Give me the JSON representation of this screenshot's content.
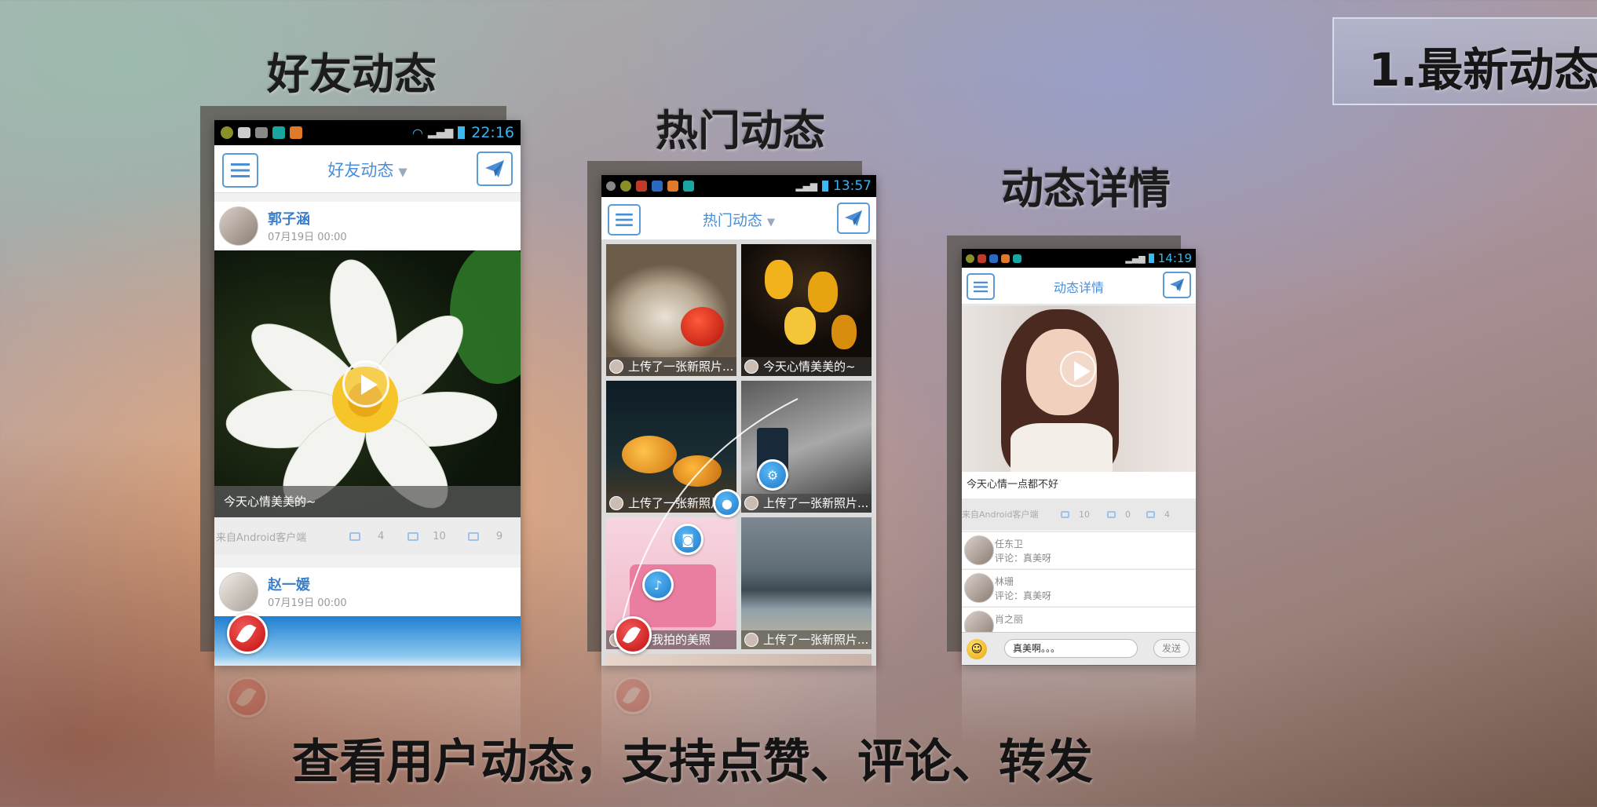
{
  "section": {
    "title": "1.最新动态"
  },
  "headings": {
    "friends": "好友动态",
    "hot": "热门动态",
    "detail": "动态详情"
  },
  "bottom_caption": "查看用户动态，支持点赞、评论、转发",
  "phone1": {
    "time": "22:16",
    "title": "好友动态",
    "posts": [
      {
        "user": "郭子涵",
        "time": "07月19日 00:00",
        "caption": "今天心情美美的~",
        "source": "来自Android客户端",
        "comments": "4",
        "forwards": "10",
        "likes": "9"
      },
      {
        "user": "赵一媛",
        "time": "07月19日 00:00"
      }
    ]
  },
  "phone2": {
    "time": "13:57",
    "title": "热门动态",
    "tiles": [
      "上传了一张新照片...",
      "今天心情美美的~",
      "上传了一张新照片...",
      "上传了一张新照片...",
      "我拍的美照",
      "上传了一张新照片..."
    ]
  },
  "phone3": {
    "time": "14:19",
    "title": "动态详情",
    "post_text": "今天心情一点都不好",
    "source": "来自Android客户端",
    "comments": "10",
    "forwards": "0",
    "likes": "4",
    "comment_list": [
      {
        "name": "任东卫",
        "text": "评论：真美呀"
      },
      {
        "name": "林珊",
        "text": "评论：真美呀"
      },
      {
        "name": "肖之丽",
        "text": ""
      }
    ],
    "input_value": "真美啊。。。",
    "send_label": "发送"
  },
  "colors": {
    "accent": "#4a8fd6",
    "fab_red": "#d21a1a",
    "fab_blue": "#2d8ad8",
    "statusbar_text": "#38b5f0"
  },
  "icons": [
    "menu-icon",
    "send-paperplane-icon",
    "play-icon",
    "comment-icon",
    "forward-icon",
    "like-icon",
    "quill-icon",
    "location-icon",
    "camera-icon",
    "mic-icon",
    "gear-icon",
    "emoji-icon"
  ]
}
